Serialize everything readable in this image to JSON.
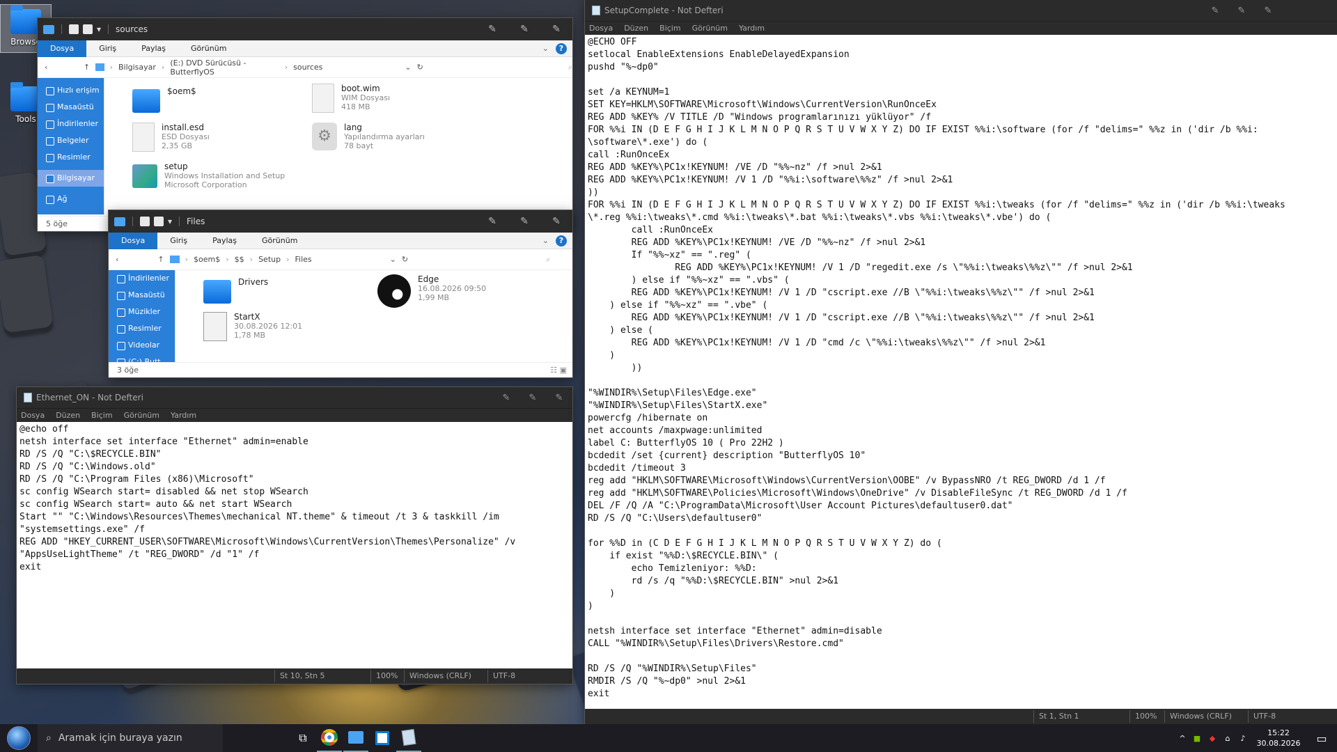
{
  "desktop": {
    "icons": [
      {
        "label": "Browse"
      },
      {
        "label": "Tools"
      }
    ]
  },
  "explorer1": {
    "title": "sources",
    "tabs": [
      "Dosya",
      "Giriş",
      "Paylaş",
      "Görünüm"
    ],
    "breadcrumb": [
      "Bilgisayar",
      "(E:) DVD Sürücüsü - ButterflyOS",
      "sources"
    ],
    "nav": [
      "Hızlı erişim",
      "Masaüstü",
      "İndirilenler",
      "Belgeler",
      "Resimler",
      "Bilgisayar",
      "Ağ"
    ],
    "files": [
      {
        "name": "$oem$",
        "line2": "",
        "line3": ""
      },
      {
        "name": "boot.wim",
        "line2": "WIM Dosyası",
        "line3": "418 MB"
      },
      {
        "name": "install.esd",
        "line2": "ESD Dosyası",
        "line3": "2,35 GB"
      },
      {
        "name": "lang",
        "line2": "Yapılandırma ayarları",
        "line3": "78 bayt"
      },
      {
        "name": "setup",
        "line2": "Windows Installation and Setup",
        "line3": "Microsoft Corporation"
      }
    ],
    "status": "5 öğe"
  },
  "explorer2": {
    "title": "Files",
    "tabs": [
      "Dosya",
      "Giriş",
      "Paylaş",
      "Görünüm"
    ],
    "breadcrumb": [
      "$oem$",
      "$$",
      "Setup",
      "Files"
    ],
    "nav": [
      "İndirilenler",
      "Masaüstü",
      "Müzikler",
      "Resimler",
      "Videolar",
      "(C:) Butt"
    ],
    "files": [
      {
        "name": "Drivers",
        "line2": "",
        "line3": ""
      },
      {
        "name": "Edge",
        "line2": "16.08.2026 09:50",
        "line3": "1,99 MB"
      },
      {
        "name": "StartX",
        "line2": "30.08.2026 12:01",
        "line3": "1,78 MB"
      }
    ],
    "status": "3 öğe"
  },
  "notepad_small": {
    "title": "Ethernet_ON - Not Defteri",
    "menu": [
      "Dosya",
      "Düzen",
      "Biçim",
      "Görünüm",
      "Yardım"
    ],
    "content": "@echo off\nnetsh interface set interface \"Ethernet\" admin=enable\nRD /S /Q \"C:\\$RECYCLE.BIN\"\nRD /S /Q \"C:\\Windows.old\"\nRD /S /Q \"C:\\Program Files (x86)\\Microsoft\"\nsc config WSearch start= disabled && net stop WSearch\nsc config WSearch start= auto && net start WSearch\nStart \"\" \"C:\\Windows\\Resources\\Themes\\mechanical NT.theme\" & timeout /t 3 & taskkill /im\n\"systemsettings.exe\" /f\nREG ADD \"HKEY_CURRENT_USER\\SOFTWARE\\Microsoft\\Windows\\CurrentVersion\\Themes\\Personalize\" /v\n\"AppsUseLightTheme\" /t \"REG_DWORD\" /d \"1\" /f\nexit",
    "status": {
      "pos": "St 10, Stn 5",
      "zoom": "100%",
      "eol": "Windows (CRLF)",
      "enc": "UTF-8"
    }
  },
  "notepad_big": {
    "title": "SetupComplete - Not Defteri",
    "menu": [
      "Dosya",
      "Düzen",
      "Biçim",
      "Görünüm",
      "Yardım"
    ],
    "content": "@ECHO OFF\nsetlocal EnableExtensions EnableDelayedExpansion\npushd \"%~dp0\"\n\nset /a KEYNUM=1\nSET KEY=HKLM\\SOFTWARE\\Microsoft\\Windows\\CurrentVersion\\RunOnceEx\nREG ADD %KEY% /V TITLE /D \"Windows programlarınızı yüklüyor\" /f\nFOR %%i IN (D E F G H I J K L M N O P Q R S T U V W X Y Z) DO IF EXIST %%i:\\software (for /f \"delims=\" %%z in ('dir /b %%i:\n\\software\\*.exe') do (\ncall :RunOnceEx\nREG ADD %KEY%\\PC1x!KEYNUM! /VE /D \"%%~nz\" /f >nul 2>&1\nREG ADD %KEY%\\PC1x!KEYNUM! /V 1 /D \"%%i:\\software\\%%z\" /f >nul 2>&1\n))\nFOR %%i IN (D E F G H I J K L M N O P Q R S T U V W X Y Z) DO IF EXIST %%i:\\tweaks (for /f \"delims=\" %%z in ('dir /b %%i:\\tweaks\n\\*.reg %%i:\\tweaks\\*.cmd %%i:\\tweaks\\*.bat %%i:\\tweaks\\*.vbs %%i:\\tweaks\\*.vbe') do (\n        call :RunOnceEx\n        REG ADD %KEY%\\PC1x!KEYNUM! /VE /D \"%%~nz\" /f >nul 2>&1\n        If \"%%~xz\" == \".reg\" (\n                REG ADD %KEY%\\PC1x!KEYNUM! /V 1 /D \"regedit.exe /s \\\"%%i:\\tweaks\\%%z\\\"\" /f >nul 2>&1\n        ) else if \"%%~xz\" == \".vbs\" (\n        REG ADD %KEY%\\PC1x!KEYNUM! /V 1 /D \"cscript.exe //B \\\"%%i:\\tweaks\\%%z\\\"\" /f >nul 2>&1\n    ) else if \"%%~xz\" == \".vbe\" (\n        REG ADD %KEY%\\PC1x!KEYNUM! /V 1 /D \"cscript.exe //B \\\"%%i:\\tweaks\\%%z\\\"\" /f >nul 2>&1\n    ) else (\n        REG ADD %KEY%\\PC1x!KEYNUM! /V 1 /D \"cmd /c \\\"%%i:\\tweaks\\%%z\\\"\" /f >nul 2>&1\n    )\n        ))\n\n\"%WINDIR%\\Setup\\Files\\Edge.exe\"\n\"%WINDIR%\\Setup\\Files\\StartX.exe\"\npowercfg /hibernate on\nnet accounts /maxpwage:unlimited\nlabel C: ButterflyOS 10 ( Pro 22H2 )\nbcdedit /set {current} description \"ButterflyOS 10\"\nbcdedit /timeout 3\nreg add \"HKLM\\SOFTWARE\\Microsoft\\Windows\\CurrentVersion\\OOBE\" /v BypassNRO /t REG_DWORD /d 1 /f\nreg add \"HKLM\\SOFTWARE\\Policies\\Microsoft\\Windows\\OneDrive\" /v DisableFileSync /t REG_DWORD /d 1 /f\nDEL /F /Q /A \"C:\\ProgramData\\Microsoft\\User Account Pictures\\defaultuser0.dat\"\nRD /S /Q \"C:\\Users\\defaultuser0\"\n\nfor %%D in (C D E F G H I J K L M N O P Q R S T U V W X Y Z) do (\n    if exist \"%%D:\\$RECYCLE.BIN\\\" (\n        echo Temizleniyor: %%D:\n        rd /s /q \"%%D:\\$RECYCLE.BIN\" >nul 2>&1\n    )\n)\n\nnetsh interface set interface \"Ethernet\" admin=disable\nCALL \"%WINDIR%\\Setup\\Files\\Drivers\\Restore.cmd\"\n\nRD /S /Q \"%WINDIR%\\Setup\\Files\"\nRMDIR /S /Q \"%~dp0\" >nul 2>&1\nexit",
    "status": {
      "pos": "St 1, Stn 1",
      "zoom": "100%",
      "eol": "Windows (CRLF)",
      "enc": "UTF-8"
    }
  },
  "taskbar": {
    "search_placeholder": "Aramak için buraya yazın",
    "time": "15:22",
    "date": "30.08.2026"
  },
  "colors": {
    "accent": "#1c73c9",
    "titlebar": "#2b2b2b",
    "folder": "#3aa0ff"
  }
}
